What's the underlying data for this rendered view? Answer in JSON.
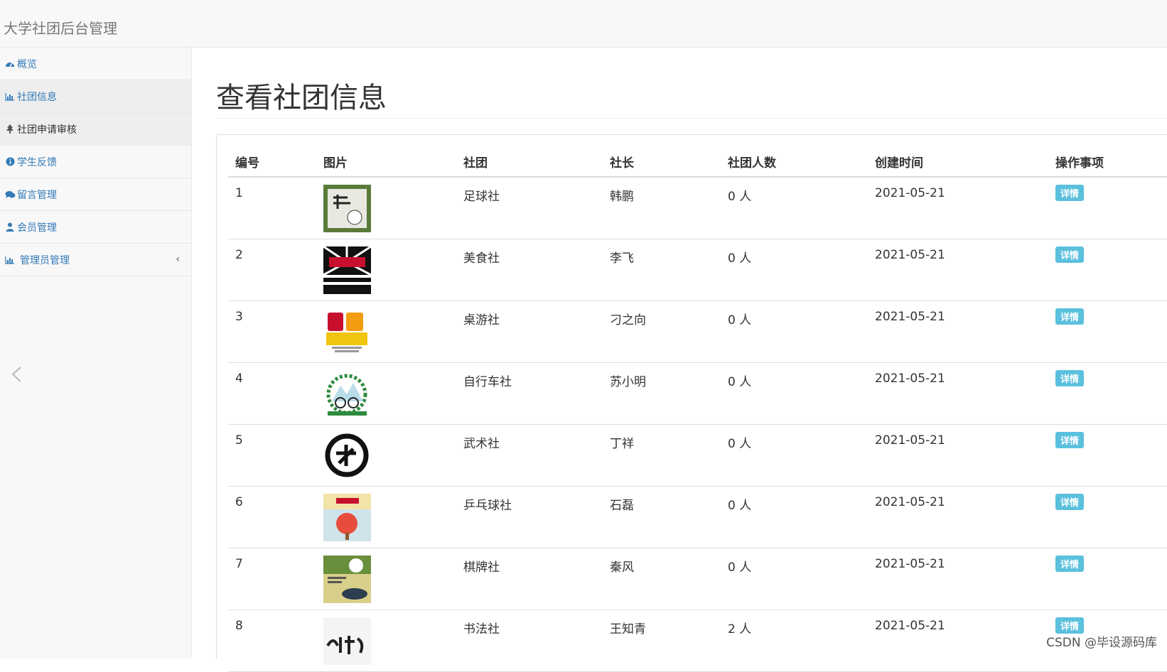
{
  "app": {
    "title": "大学社团后台管理"
  },
  "sidebar": {
    "items": [
      {
        "label": "概览",
        "icon": "dashboard-icon",
        "active": false
      },
      {
        "label": "社团信息",
        "icon": "bar-chart-icon",
        "active": true
      },
      {
        "label": "社团申请审核",
        "icon": "tree-icon",
        "active": true
      },
      {
        "label": "学生反馈",
        "icon": "info-circle-icon",
        "active": false
      },
      {
        "label": "留言管理",
        "icon": "comments-icon",
        "active": false
      },
      {
        "label": "会员管理",
        "icon": "user-icon",
        "active": false
      },
      {
        "label": "管理员管理",
        "icon": "bar-chart-icon",
        "active": false,
        "has_submenu": true
      }
    ]
  },
  "main": {
    "page_title": "查看社团信息",
    "table": {
      "headers": [
        "编号",
        "图片",
        "社团",
        "社长",
        "社团人数",
        "创建时间",
        "操作事项"
      ],
      "action_label": "详情",
      "rows": [
        {
          "id": "1",
          "image": "football-club-logo",
          "name": "足球社",
          "leader": "韩鹏",
          "members": "0 人",
          "created": "2021-05-21"
        },
        {
          "id": "2",
          "image": "food-club-logo",
          "name": "美食社",
          "leader": "李飞",
          "members": "0 人",
          "created": "2021-05-21"
        },
        {
          "id": "3",
          "image": "boardgame-club-logo",
          "name": "桌游社",
          "leader": "刁之向",
          "members": "0 人",
          "created": "2021-05-21"
        },
        {
          "id": "4",
          "image": "cycling-club-logo",
          "name": "自行车社",
          "leader": "苏小明",
          "members": "0 人",
          "created": "2021-05-21"
        },
        {
          "id": "5",
          "image": "martial-arts-club-logo",
          "name": "武术社",
          "leader": "丁祥",
          "members": "0 人",
          "created": "2021-05-21"
        },
        {
          "id": "6",
          "image": "pingpong-club-logo",
          "name": "乒乓球社",
          "leader": "石磊",
          "members": "0 人",
          "created": "2021-05-21"
        },
        {
          "id": "7",
          "image": "chess-club-logo",
          "name": "棋牌社",
          "leader": "秦风",
          "members": "0 人",
          "created": "2021-05-21"
        },
        {
          "id": "8",
          "image": "calligraphy-club-logo",
          "name": "书法社",
          "leader": "王知青",
          "members": "2 人",
          "created": "2021-05-21"
        }
      ]
    }
  },
  "watermark": "CSDN @毕设源码库",
  "colors": {
    "link": "#337ab7",
    "info_button": "#5bc0de",
    "sidebar_bg": "#f8f8f8"
  }
}
